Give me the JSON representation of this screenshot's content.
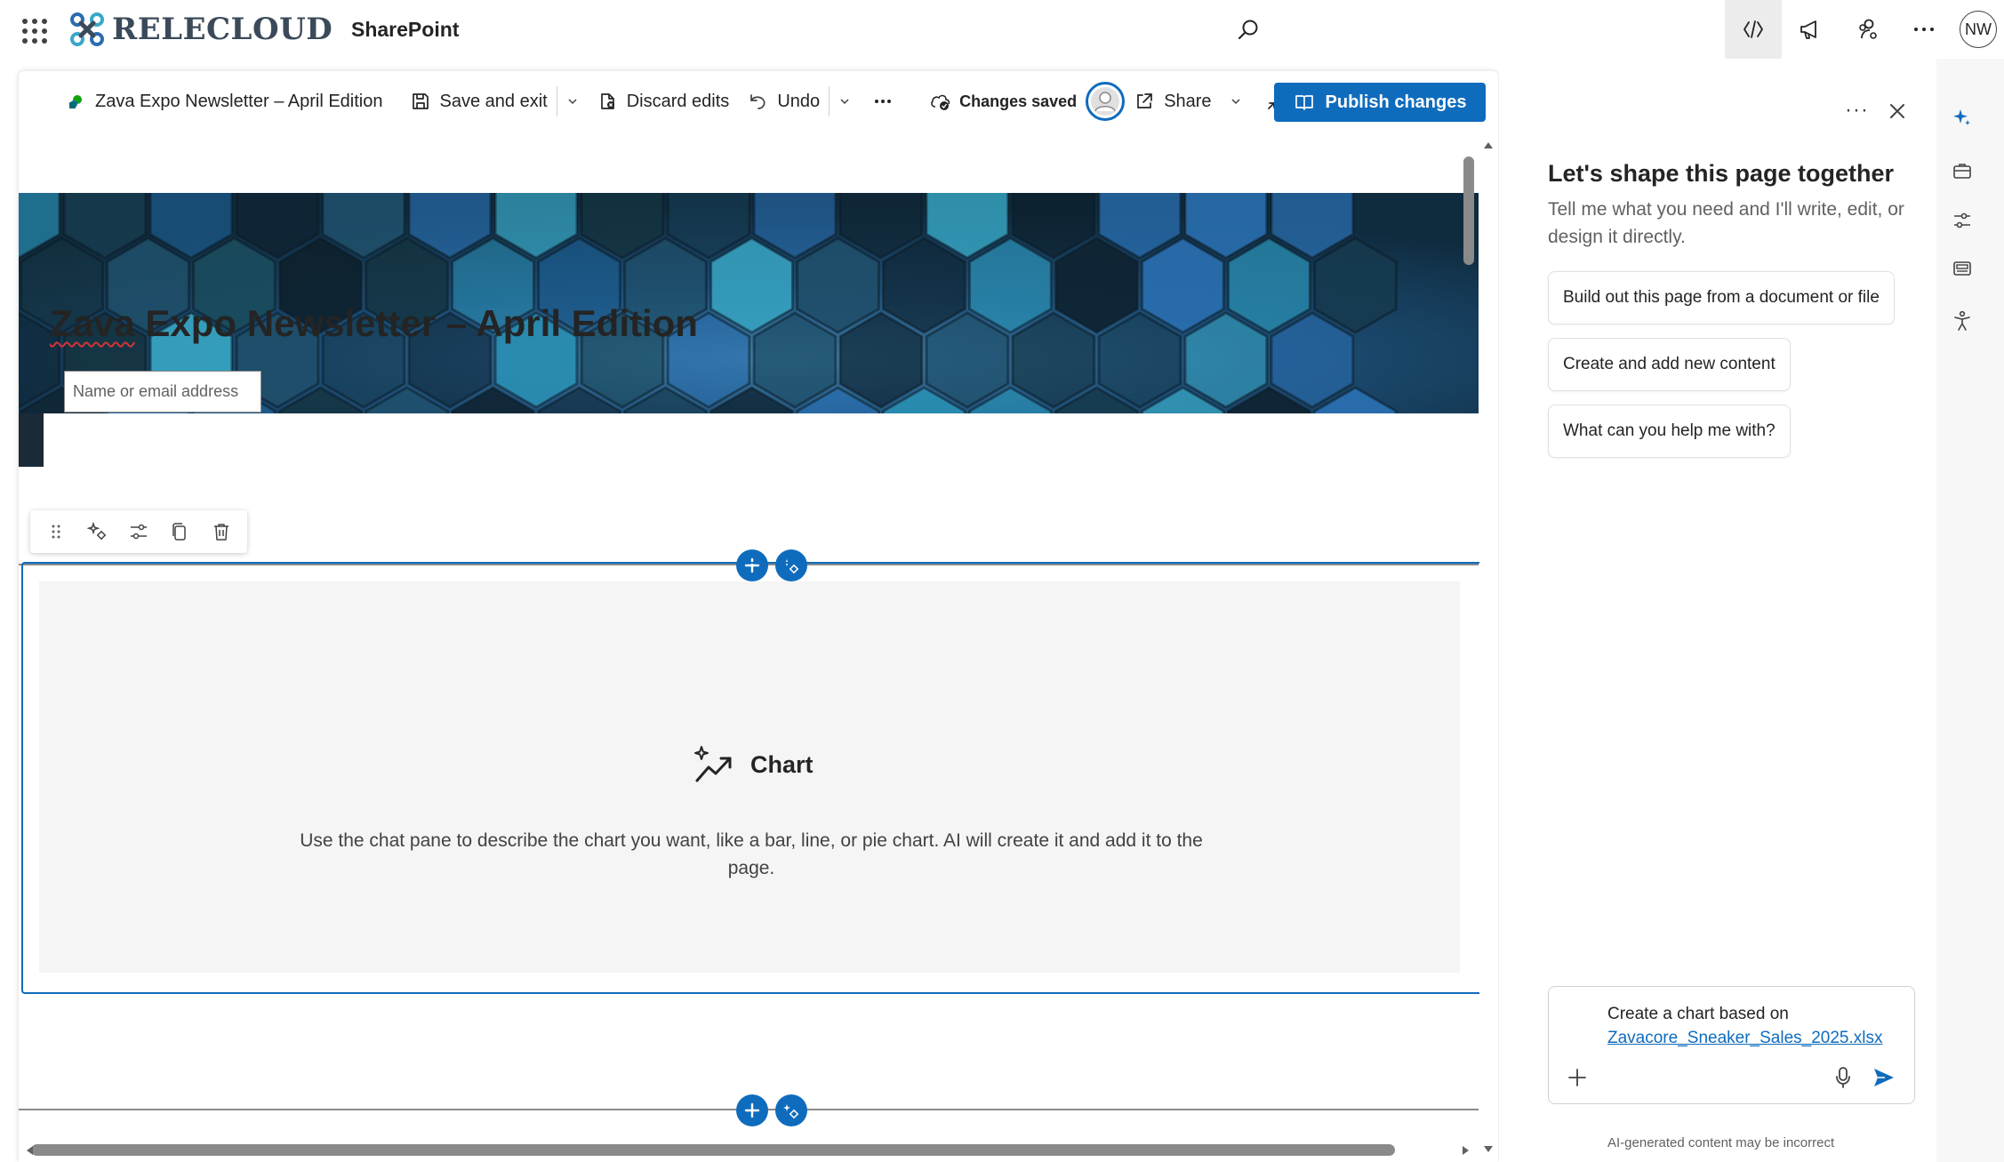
{
  "suite": {
    "brand": "RELECLOUD",
    "app": "SharePoint",
    "user_initials": "NW"
  },
  "command_bar": {
    "page_name": "Zava Expo Newsletter – April Edition",
    "save_exit": "Save and exit",
    "discard": "Discard edits",
    "undo": "Undo",
    "status": "Changes saved",
    "share": "Share",
    "publish": "Publish changes"
  },
  "page": {
    "title_first": "Zava",
    "title_rest": " Expo Newsletter – April Edition",
    "author_placeholder": "Name or email address"
  },
  "webpart": {
    "title": "Chart",
    "description": "Use the chat pane to describe the chart you want, like a bar, line, or pie chart. AI will create it and add it to the page."
  },
  "copilot": {
    "more": "···",
    "title": "Let's shape this page together",
    "subtitle": "Tell me what you need and I'll write, edit, or design it directly.",
    "suggestions": [
      "Build out this page from a document or file",
      "Create and add new content",
      "What can you help me with?"
    ],
    "composer_text": "Create a chart based on",
    "composer_file": "Zavacore_Sneaker_Sales_2025.xlsx",
    "disclaimer": "AI-generated content may be incorrect"
  },
  "colors": {
    "accent": "#0f6cbd",
    "brand_text": "#3b4a5a",
    "brand_icon_a": "#2b6cb0",
    "brand_icon_b": "#3aa7c9"
  }
}
